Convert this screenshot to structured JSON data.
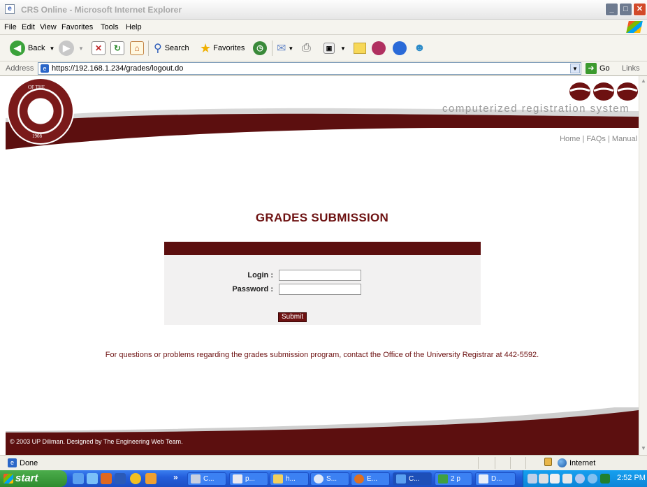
{
  "window": {
    "title": "CRS Online - Microsoft Internet Explorer"
  },
  "menubar": {
    "items": [
      "File",
      "Edit",
      "View",
      "Favorites",
      "Tools",
      "Help"
    ]
  },
  "toolbar": {
    "back_label": "Back",
    "search_label": "Search",
    "favorites_label": "Favorites"
  },
  "address": {
    "label": "Address",
    "url": "https://192.168.1.234/grades/logout.do",
    "go_label": "Go",
    "links_label": "Links"
  },
  "site": {
    "tagline": "computerized registration system",
    "seal_text": "OF THE",
    "seal_year": "1908",
    "nav": {
      "home": "Home",
      "faqs": "FAQs",
      "manual": "Manual",
      "sep": "|"
    }
  },
  "page": {
    "heading": "GRADES SUBMISSION",
    "login_label": "Login :",
    "password_label": "Password :",
    "submit_label": "Submit",
    "help_text": "For questions or problems regarding the grades submission program, contact the Office of the University Registrar at 442-5592.",
    "footer": "© 2003 UP Diliman. Designed by The Engineering Web Team."
  },
  "statusbar": {
    "status": "Done",
    "zone": "Internet"
  },
  "taskbar": {
    "start_label": "start",
    "more": "»",
    "tasks": [
      "C...",
      "p...",
      "h...",
      "S...",
      "E...",
      "C...",
      "2 p",
      "D..."
    ],
    "clock": "2:52 PM"
  },
  "colors": {
    "maroon": "#6d1111",
    "dark_maroon": "#5c0f0f",
    "xp_blue": "#245edb"
  }
}
